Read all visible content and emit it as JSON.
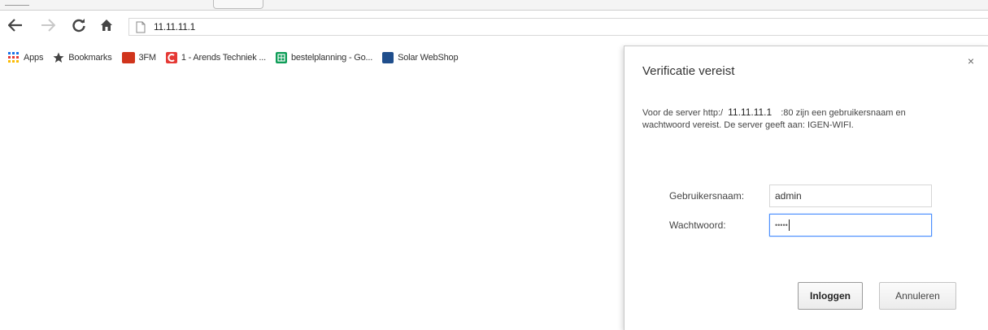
{
  "toolbar": {
    "url": "11.11.11.1",
    "back_icon": "arrow-left-icon",
    "forward_icon": "arrow-right-icon",
    "reload_icon": "reload-icon",
    "home_icon": "home-icon",
    "page_icon": "page-icon"
  },
  "bookmarks": [
    {
      "label": "Apps",
      "icon": "apps-grid-icon",
      "color": "#1a73e8"
    },
    {
      "label": "Bookmarks",
      "icon": "star-icon",
      "color": "#444444"
    },
    {
      "label": "3FM",
      "icon": "3fm-favicon",
      "color": "#d0341c"
    },
    {
      "label": "1 - Arends Techniek ...",
      "icon": "arends-favicon",
      "color": "#e53935"
    },
    {
      "label": "bestelplanning - Go...",
      "icon": "sheets-favicon",
      "color": "#0f9d58"
    },
    {
      "label": "Solar WebShop",
      "icon": "solar-favicon",
      "color": "#1f4e8c"
    }
  ],
  "dialog": {
    "title": "Verificatie vereist",
    "close_label": "×",
    "message_prefix": "Voor de server http:/",
    "message_host": "11.11.11.1",
    "message_suffix": ":80 zijn een gebruikersnaam en wachtwoord vereist. De server geeft aan: IGEN-WIFI.",
    "username_label": "Gebruikersnaam:",
    "username_value": "admin",
    "password_label": "Wachtwoord:",
    "password_value": "•••••",
    "login_button": "Inloggen",
    "cancel_button": "Annuleren"
  }
}
